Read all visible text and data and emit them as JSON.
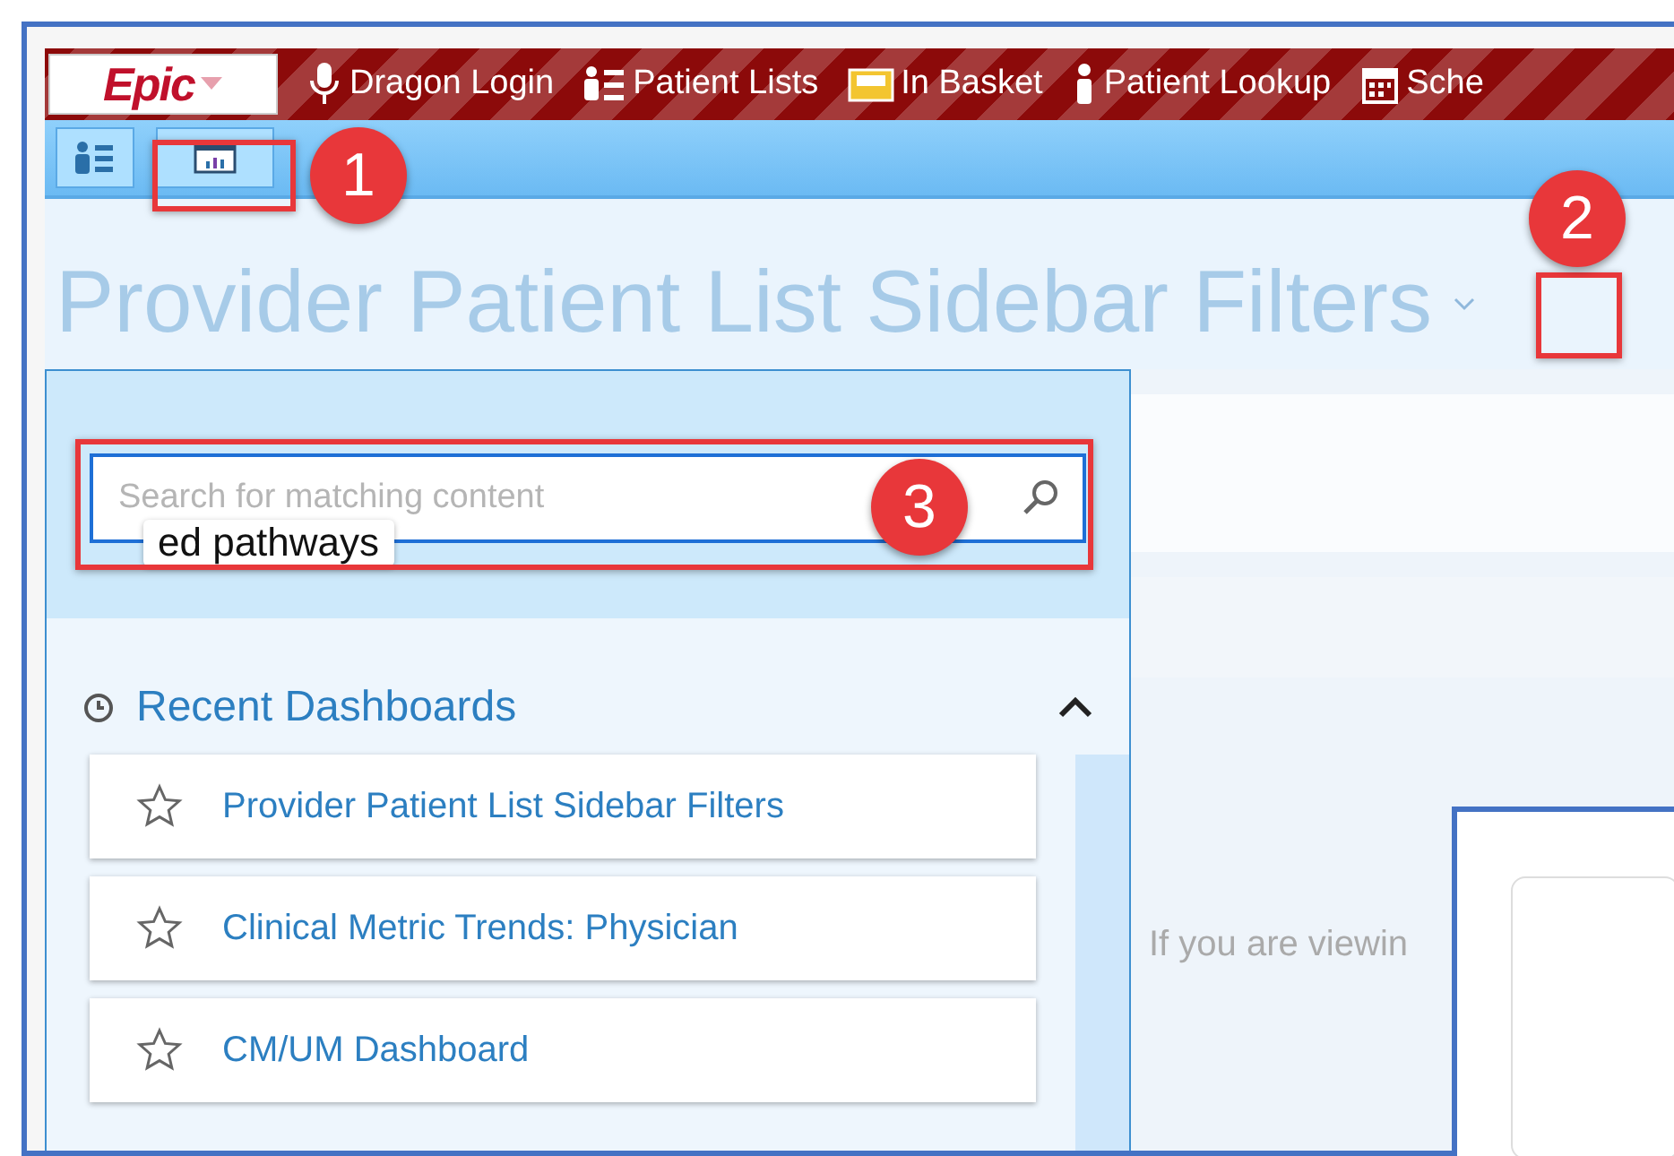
{
  "nav": {
    "logo": "Epic",
    "items": [
      {
        "kind": "microphone",
        "label": "Dragon Login"
      },
      {
        "kind": "list",
        "label": "Patient Lists"
      },
      {
        "kind": "inbox",
        "label": "In Basket"
      },
      {
        "kind": "person",
        "label": "Patient Lookup"
      },
      {
        "kind": "calendar",
        "label": "Sche"
      }
    ]
  },
  "toolbar": [
    {
      "kind": "list"
    },
    {
      "kind": "dashboard"
    }
  ],
  "title": "Provider Patient List Sidebar Filters",
  "search": {
    "placeholder": "Search for matching content",
    "tooltip": "ed pathways"
  },
  "recent": {
    "heading": "Recent Dashboards",
    "items": [
      {
        "label": "Provider Patient List Sidebar Filters",
        "starred": false
      },
      {
        "label": "Clinical Metric Trends: Physician",
        "starred": false
      },
      {
        "label": "CM/UM Dashboard",
        "starred": false
      }
    ]
  },
  "main": {
    "note": "If you are viewin"
  },
  "callouts": [
    "1",
    "2",
    "3"
  ]
}
